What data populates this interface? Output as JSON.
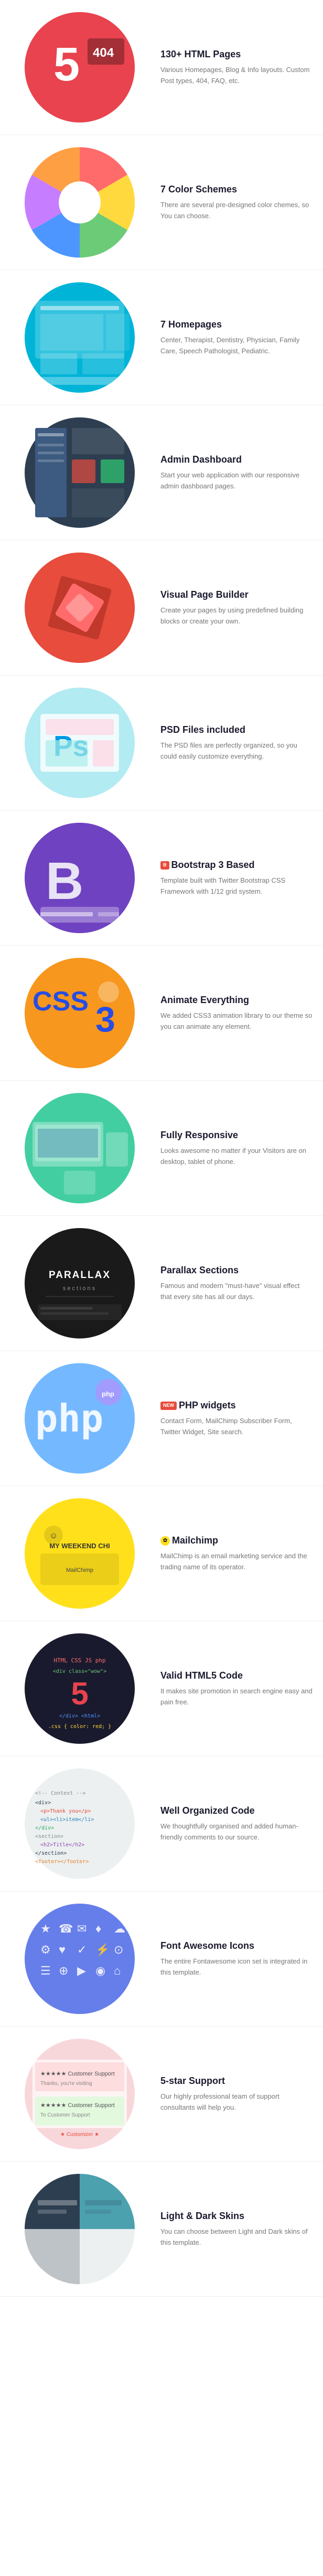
{
  "features": [
    {
      "id": "html-pages",
      "title": "130+ HTML Pages",
      "desc": "Various Homepages, Blog & Info layouts. Custom Post types, 404, FAQ, etc.",
      "img_type": "html5"
    },
    {
      "id": "color-schemes",
      "title": "7 Color Schemes",
      "desc": "There are several pre-designed color chemes, so You can choose.",
      "img_type": "colors"
    },
    {
      "id": "homepages",
      "title": "7 Homepages",
      "desc": "Center, Therapist, Dentistry, Physician, Family Care, Speech Pathologist, Pediatric.",
      "img_type": "homepages"
    },
    {
      "id": "admin-dashboard",
      "title": "Admin Dashboard",
      "desc": "Start your web application with our responsive admin dashboard pages.",
      "img_type": "admin"
    },
    {
      "id": "page-builder",
      "title": "Visual Page Builder",
      "desc": "Create your pages by using predefined building blocks or create your own.",
      "img_type": "builder"
    },
    {
      "id": "psd-files",
      "title": "PSD Files included",
      "desc": "The PSD files are perfectly organized, so you could easily customize everything.",
      "img_type": "psd"
    },
    {
      "id": "bootstrap",
      "title": "Bootstrap 3 Based",
      "desc": "Template built with Twitter Bootstrap CSS Framework with 1/12 grid system.",
      "img_type": "bootstrap",
      "badge": "B"
    },
    {
      "id": "animate",
      "title": "Animate Everything",
      "desc": "We added CSS3 animation library to our theme so you can animate any element.",
      "img_type": "animate"
    },
    {
      "id": "responsive",
      "title": "Fully Responsive",
      "desc": "Looks awesome no matter if your Visitors are on desktop, tablet of phone.",
      "img_type": "responsive"
    },
    {
      "id": "parallax",
      "title": "Parallax Sections",
      "desc": "Famous and modern \"must-have\" visual effect that every site has all our days.",
      "img_type": "parallax",
      "parallax_line1": "PARALLAX",
      "parallax_line2": "sections"
    },
    {
      "id": "php-widgets",
      "title": "PHP widgets",
      "desc": "Contact Form, MailChimp Subscriber Form, Twitter Widget, Site search.",
      "img_type": "php",
      "badge_label": "NEW",
      "php_text": "php"
    },
    {
      "id": "mailchimp",
      "title": "Mailchimp",
      "desc": "MailChimp is an email marketing service and the trading name of its operator.",
      "img_type": "mailchimp",
      "chi_text": "MY WEEKEND CHI"
    },
    {
      "id": "html5-code",
      "title": "Valid HTML5 Code",
      "desc": "It makes site promotion in search engine easy and pain free.",
      "img_type": "html5code"
    },
    {
      "id": "organized-code",
      "title": "Well Organized Code",
      "desc": "We thoughtfully organised and added human-friendly comments to our source.",
      "img_type": "organized"
    },
    {
      "id": "font-awesome",
      "title": "Font Awesome Icons",
      "desc": "The entire Fontawesome icon set is integrated in this template.",
      "img_type": "fontawesome"
    },
    {
      "id": "support",
      "title": "5-star Support",
      "desc": "Our highly professional team of support consultants will help you.",
      "img_type": "support",
      "stars": "★★★★★"
    },
    {
      "id": "dark-skins",
      "title": "Light & Dark Skins",
      "desc": "You can choose between Light and Dark skins of this template.",
      "img_type": "darkskin"
    }
  ]
}
